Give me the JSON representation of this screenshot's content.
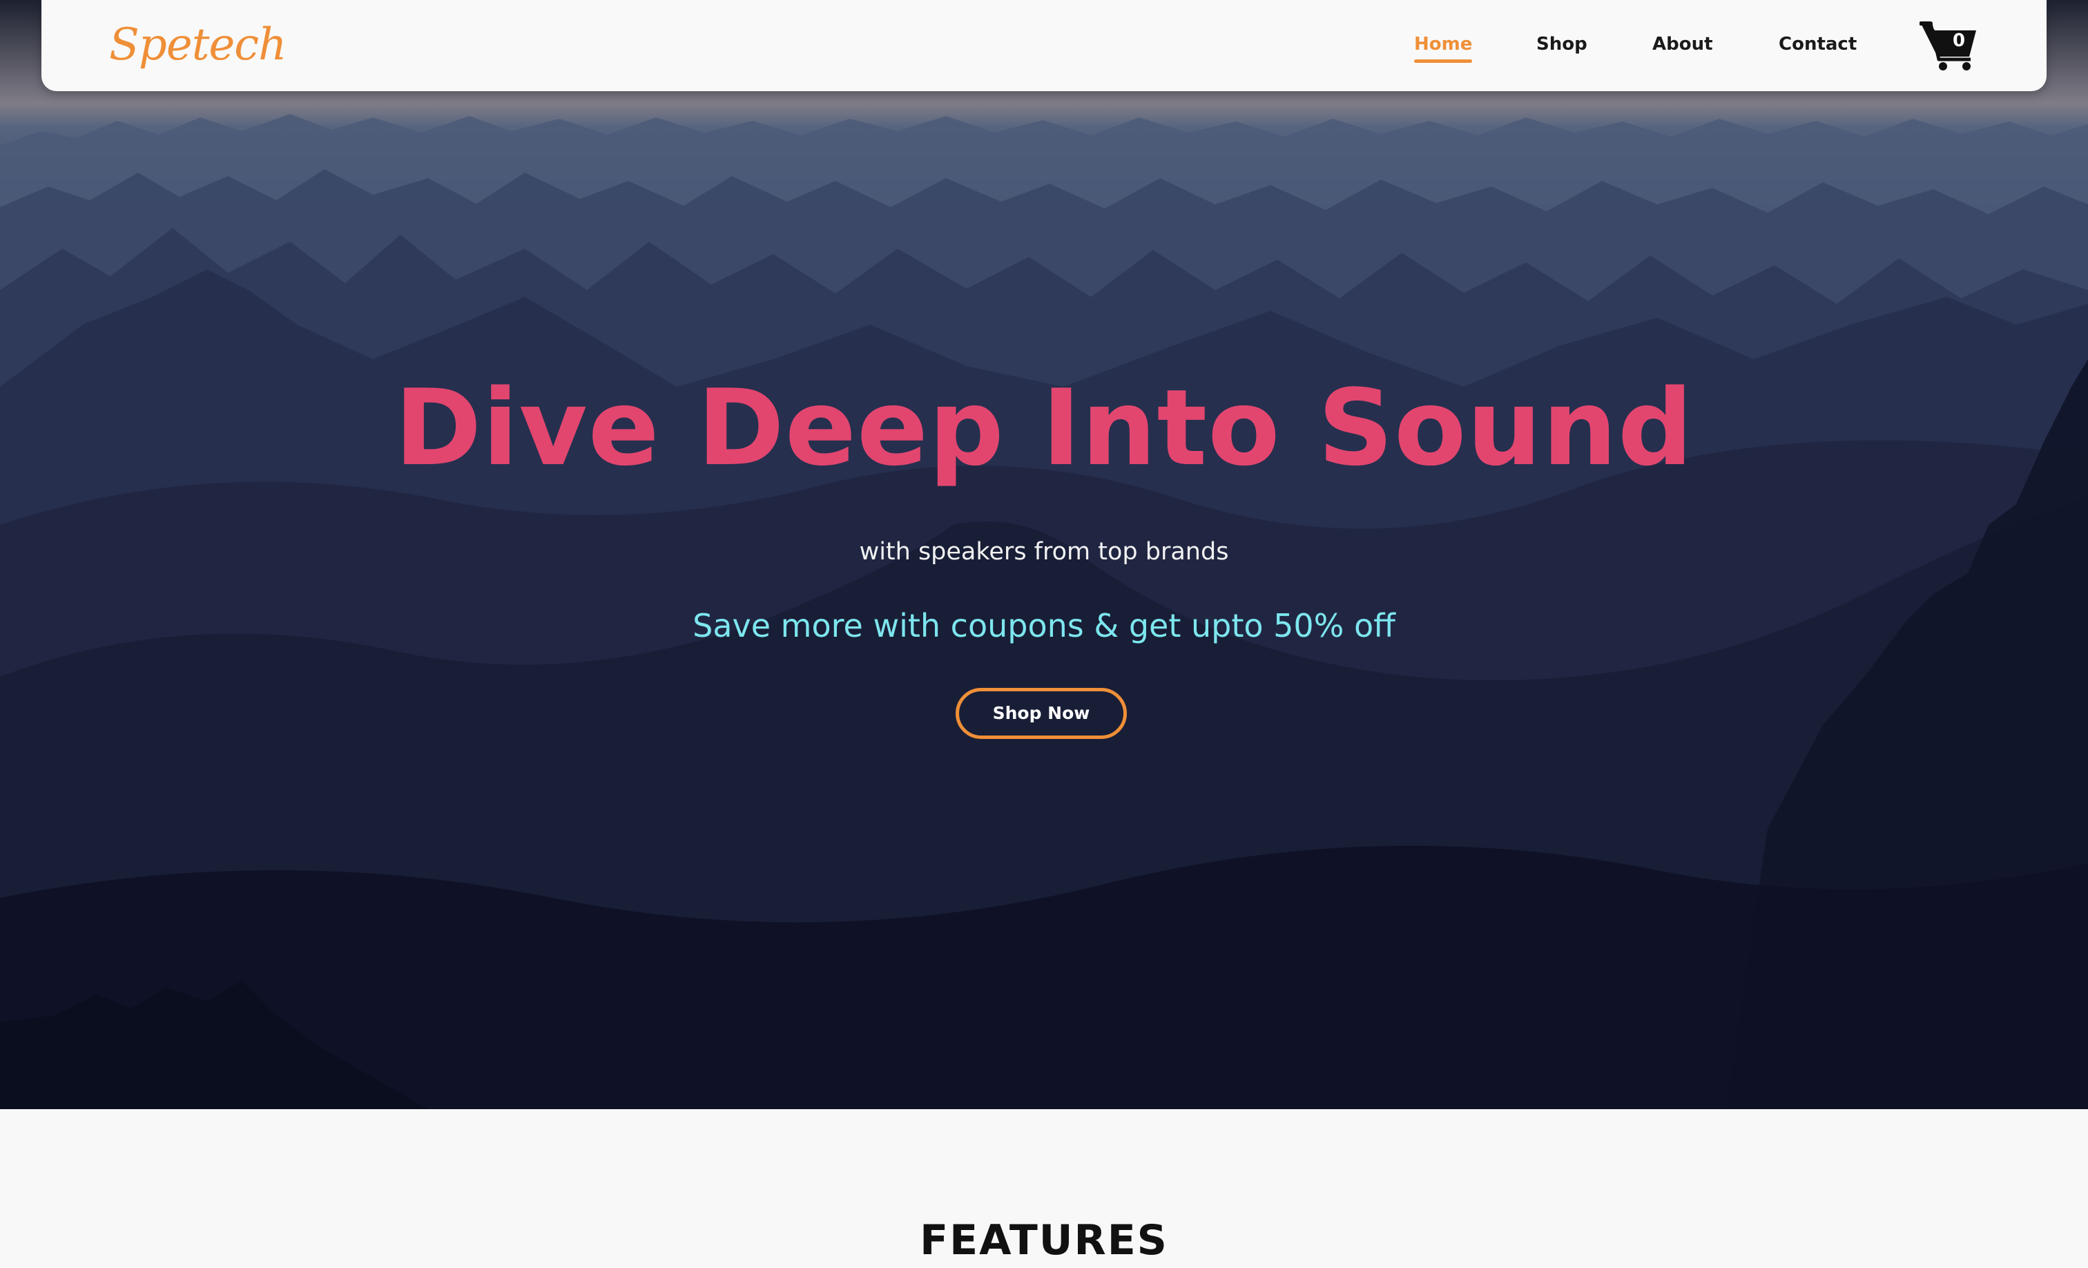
{
  "brand": {
    "logo_text": "Spetech"
  },
  "nav": {
    "items": [
      {
        "label": "Home",
        "active": true
      },
      {
        "label": "Shop",
        "active": false
      },
      {
        "label": "About",
        "active": false
      },
      {
        "label": "Contact",
        "active": false
      }
    ],
    "cart_count": "0",
    "cart_icon": "shopping-cart-icon"
  },
  "hero": {
    "title": "Dive Deep Into Sound",
    "subtitle": "with speakers from top brands",
    "offer": "Save more with coupons & get upto 50% off",
    "cta_label": "Shop Now"
  },
  "features": {
    "title": "FEATURES"
  },
  "colors": {
    "accent": "#ef8f38",
    "title_pink": "#e2466f",
    "offer_cyan": "#7de6ee",
    "navbar_bg": "#f9f9f9",
    "page_bg": "#f8f8f8"
  }
}
